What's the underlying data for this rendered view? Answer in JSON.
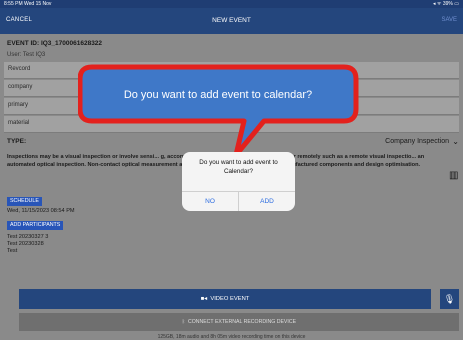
{
  "status_bar": {
    "left": "8:55 PM  Wed 15 Nov",
    "right": "◂ ᯤ 39% ▭"
  },
  "nav": {
    "cancel": "CANCEL",
    "title": "NEW EVENT",
    "save": "SAVE"
  },
  "event": {
    "id_label": "EVENT ID: IQ3_1700061628322",
    "user": "User: Test IQ3"
  },
  "fields": [
    {
      "label": "Revcord"
    },
    {
      "label": "company"
    },
    {
      "label": "primary"
    },
    {
      "label": "material"
    }
  ],
  "type": {
    "label": "TYPE:",
    "value": "Company Inspection"
  },
  "description": "Inspections may be a visual inspection or involve sensi... g, accomplished with a direct physical presence or remotely such as a remote visual inspectio... an automated optical inspection. Non-contact optical measurement and photogrammetry ha... spection of manufactured components and design optimisation.",
  "schedule": {
    "button": "SCHEDULE",
    "datetime": "Wed, 11/15/2023 08:54 PM"
  },
  "participants": {
    "button": "ADD PARTICIPANTS",
    "names": [
      "Test 20230327 3",
      "Test 20230328",
      "Test"
    ]
  },
  "actions": {
    "video_event": "VIDEO EVENT",
    "connect_device": "CONNECT EXTERNAL RECORDING DEVICE"
  },
  "footer": "125GB, 18m audio and 8h 05m video recording time on this device",
  "callout": {
    "text": "Do you want to add event to calendar?",
    "fill": "#3f78c8",
    "border": "#e3211d"
  },
  "alert": {
    "message": "Do you want to add event to Calendar?",
    "no": "NO",
    "add": "ADD"
  },
  "colors": {
    "navbar": "#24467d",
    "primary_button": "#2855b8"
  }
}
